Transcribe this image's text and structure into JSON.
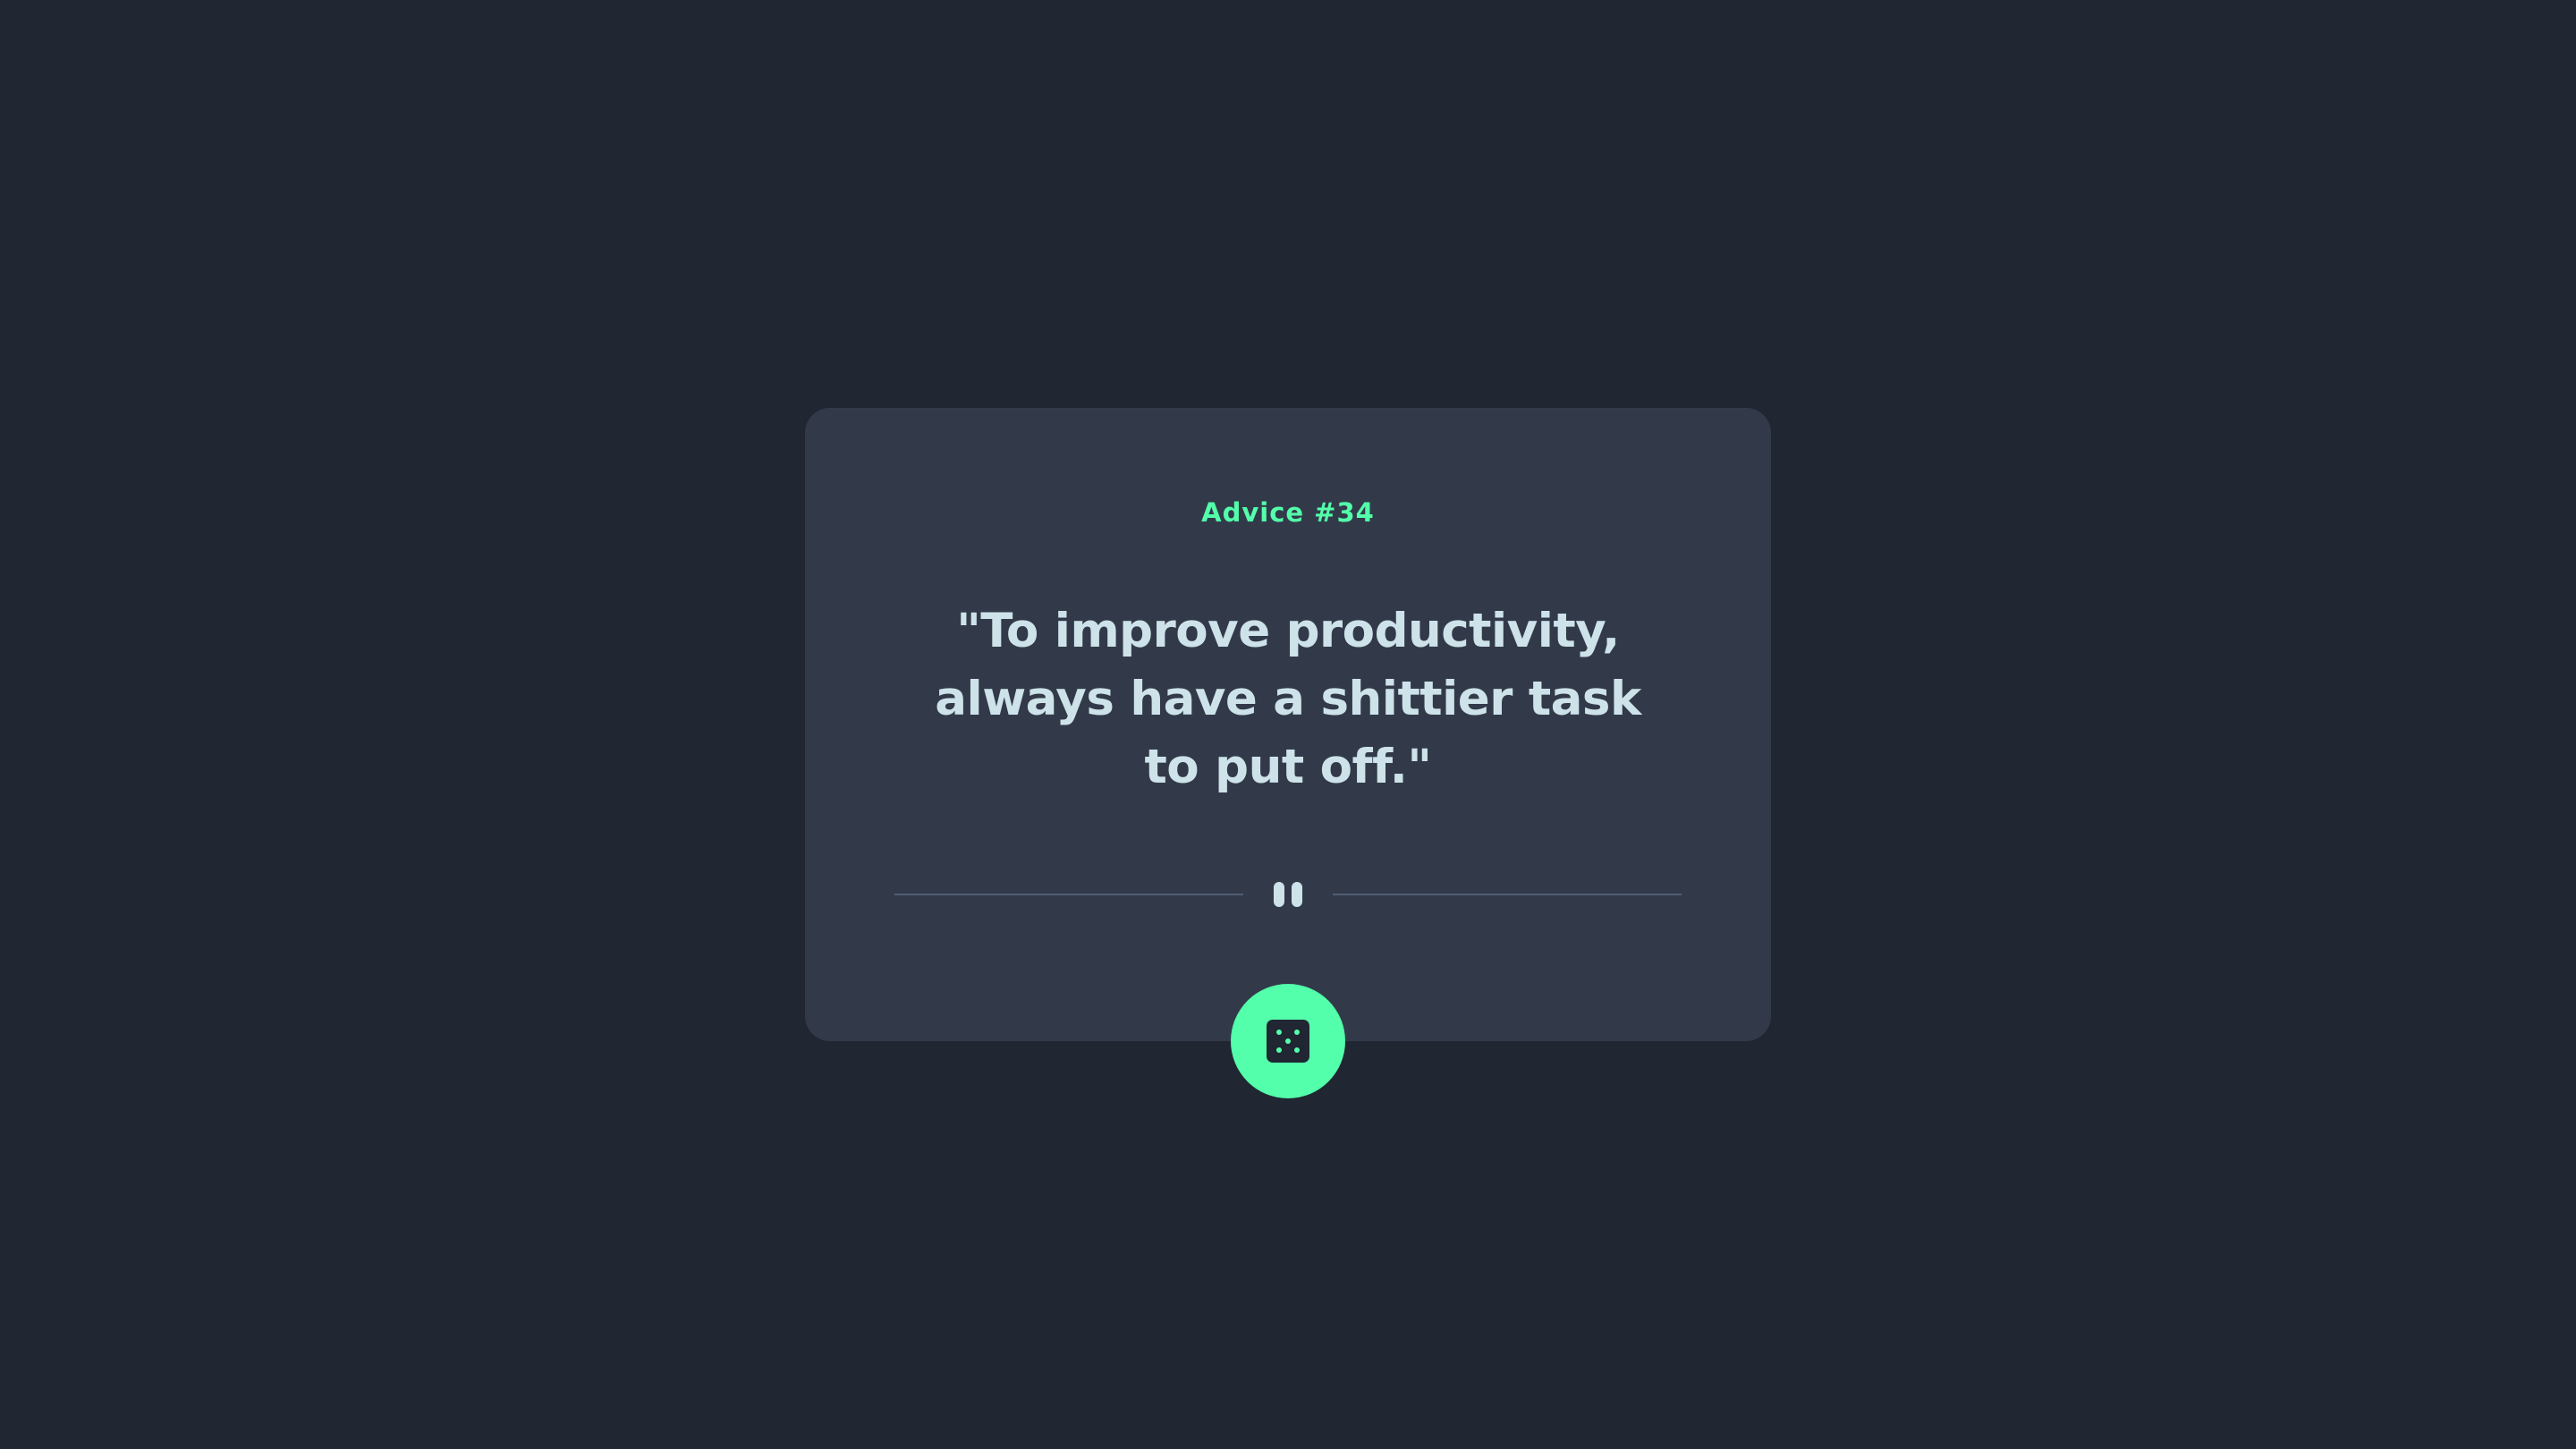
{
  "advice": {
    "label": "Advice #34",
    "quote": "\"To improve productivity, always have a shittier task to put off.\""
  },
  "colors": {
    "background": "#202632",
    "card": "#323a4a",
    "accent": "#53ffaa",
    "text": "#cee3e9",
    "divider": "#4f5d74"
  },
  "icons": {
    "divider_icon": "pause-icon",
    "button_icon": "dice-icon"
  }
}
